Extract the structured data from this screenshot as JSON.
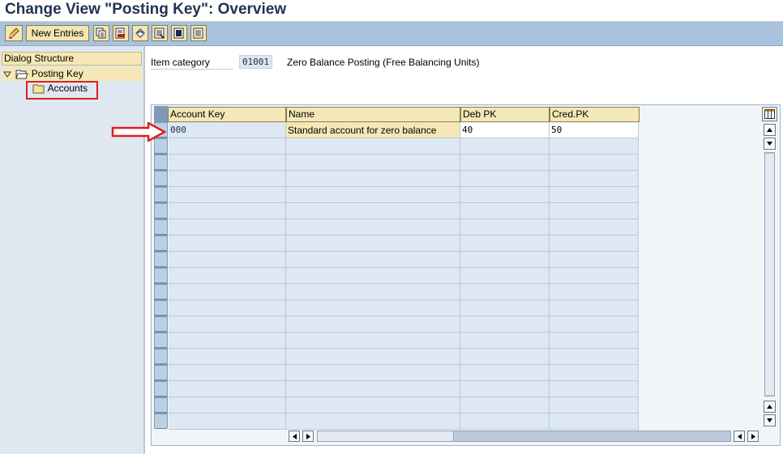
{
  "window": {
    "title": "Change View \"Posting Key\": Overview"
  },
  "toolbar": {
    "new_entries_label": "New Entries",
    "icons": [
      "edit-pencil-icon",
      "copy-icon",
      "delete-icon",
      "undo-icon",
      "select-all-icon",
      "select-block-icon",
      "deselect-all-icon"
    ]
  },
  "dialog_structure": {
    "header": "Dialog Structure",
    "items": [
      {
        "label": "Posting Key",
        "expanded": true,
        "selected": true
      },
      {
        "label": "Accounts",
        "highlighted": true
      }
    ]
  },
  "header_fields": {
    "item_category_label": "Item category",
    "item_category_value": "01001",
    "item_category_desc": "Zero Balance Posting (Free Balancing Units)"
  },
  "table": {
    "columns": [
      "Account Key",
      "Name",
      "Deb PK",
      "Cred.PK"
    ],
    "rows": [
      {
        "account_key": "000",
        "name": "Standard account for zero balance",
        "deb_pk": "40",
        "cred_pk": "50"
      }
    ],
    "empty_rows": 18
  },
  "colors": {
    "toolbar_bg": "#a9c2dd",
    "header_bg": "#f4e8b8",
    "cell_bg": "#dde8f2",
    "annotation_red": "#e01e1e"
  }
}
